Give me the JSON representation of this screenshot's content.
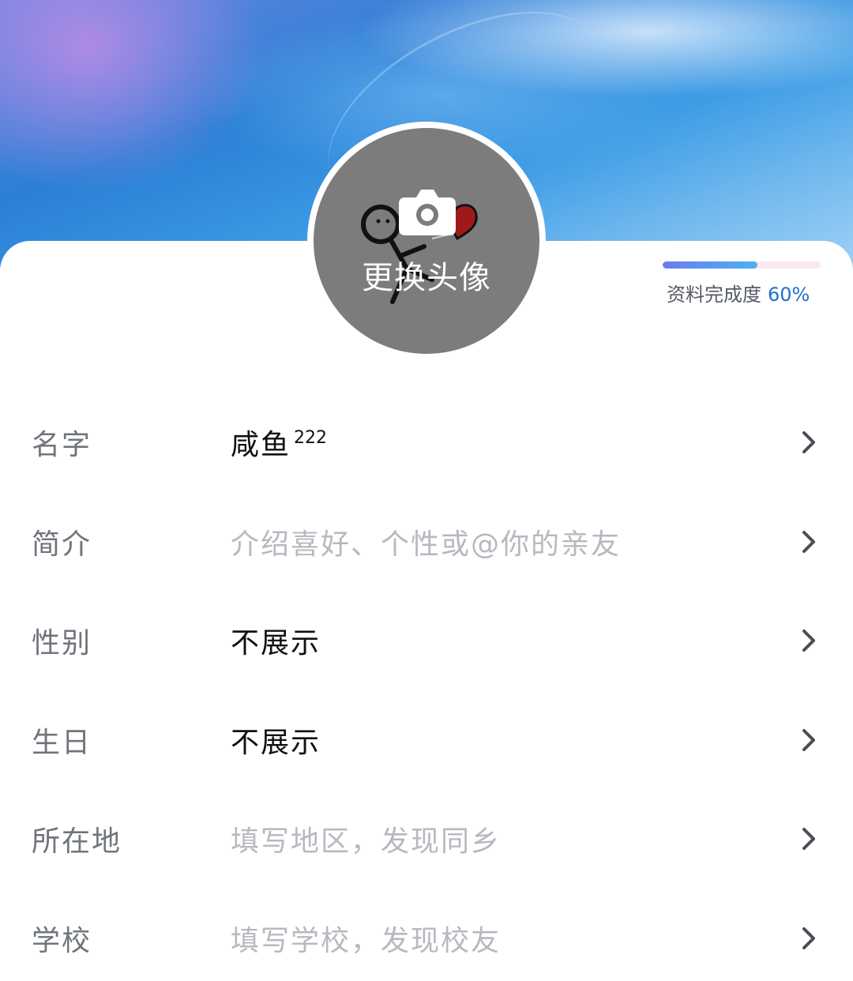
{
  "avatar": {
    "change_label": "更换头像"
  },
  "completion": {
    "label": "资料完成度",
    "value_text": "60%",
    "fraction": 0.6
  },
  "fields": [
    {
      "key": "name",
      "label": "名字",
      "value": "咸鱼",
      "value_sup": "222",
      "is_placeholder": false
    },
    {
      "key": "intro",
      "label": "简介",
      "value": "介绍喜好、个性或@你的亲友",
      "is_placeholder": true
    },
    {
      "key": "gender",
      "label": "性别",
      "value": "不展示",
      "is_placeholder": false
    },
    {
      "key": "birthday",
      "label": "生日",
      "value": "不展示",
      "is_placeholder": false
    },
    {
      "key": "location",
      "label": "所在地",
      "value": "填写地区，发现同乡",
      "is_placeholder": true
    },
    {
      "key": "school",
      "label": "学校",
      "value": "填写学校，发现校友",
      "is_placeholder": true
    }
  ],
  "icons": {
    "camera": "camera-icon",
    "row_arrow": "chevron-right-icon"
  },
  "colors": {
    "progress_start": "#6b7cf0",
    "progress_end": "#4bb1f0",
    "completion_value": "#1f6fd0",
    "placeholder_text": "#b6b9bf"
  }
}
